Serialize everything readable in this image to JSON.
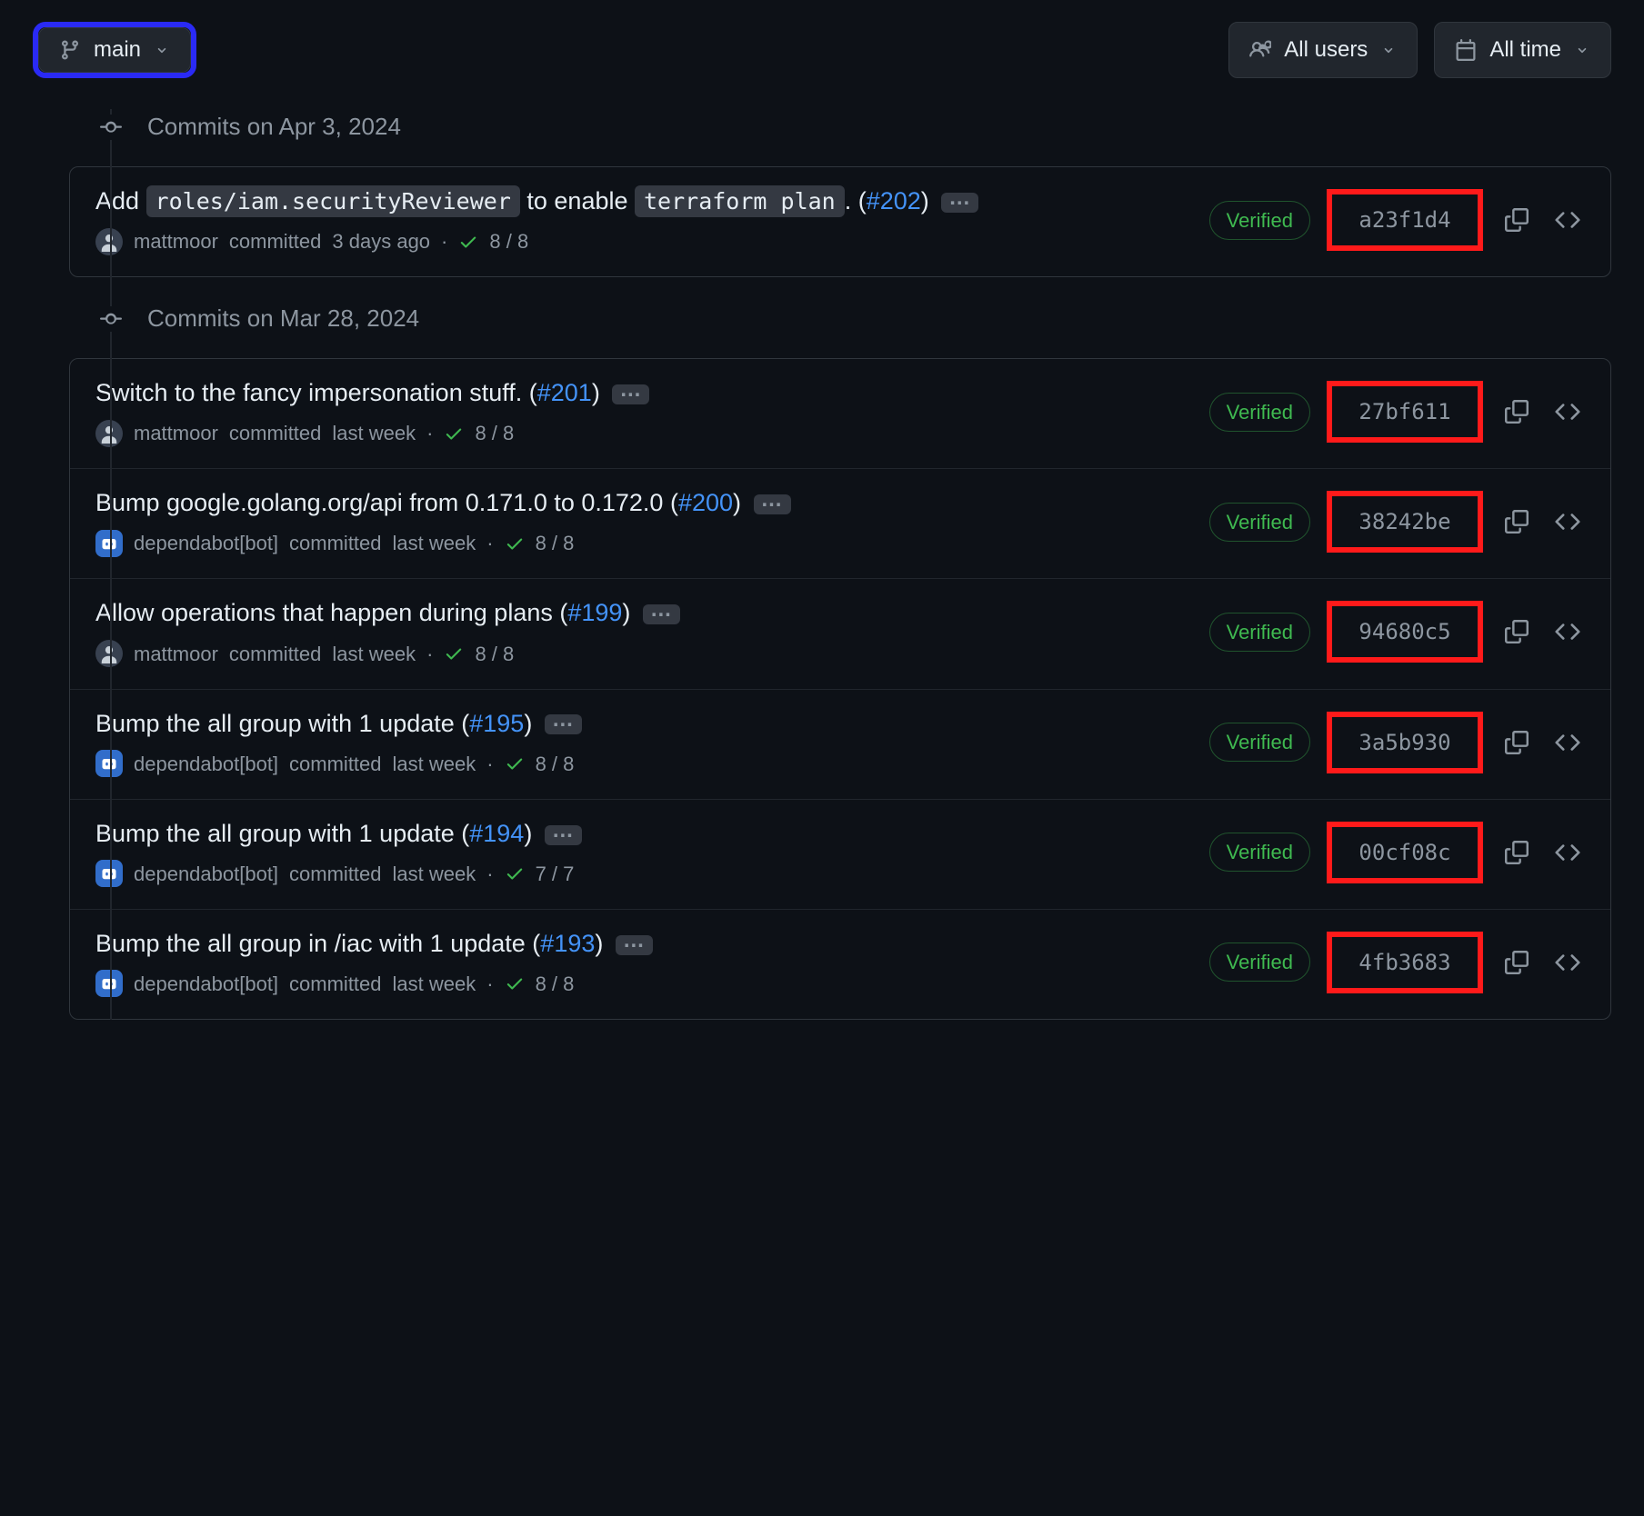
{
  "toolbar": {
    "branch_label": "main",
    "users_label": "All users",
    "time_label": "All time"
  },
  "groups": [
    {
      "date_label": "Commits on Apr 3, 2024",
      "commits": [
        {
          "title_pre": "Add ",
          "code1": "roles/iam.securityReviewer",
          "mid": " to enable ",
          "code2": "terraform plan",
          "post": ". (",
          "pr": "#202",
          "close": ")",
          "author": "mattmoor",
          "author_kind": "user",
          "time_ago": "3 days ago",
          "checks": "8 / 8",
          "verified": "Verified",
          "sha": "a23f1d4"
        }
      ]
    },
    {
      "date_label": "Commits on Mar 28, 2024",
      "commits": [
        {
          "title_pre": "Switch to the fancy impersonation stuff. (",
          "pr": "#201",
          "close": ")",
          "author": "mattmoor",
          "author_kind": "user",
          "time_ago": "last week",
          "checks": "8 / 8",
          "verified": "Verified",
          "sha": "27bf611"
        },
        {
          "title_pre": "Bump google.golang.org/api from 0.171.0 to 0.172.0 (",
          "pr": "#200",
          "close": ")",
          "author": "dependabot[bot]",
          "author_kind": "bot",
          "time_ago": "last week",
          "checks": "8 / 8",
          "verified": "Verified",
          "sha": "38242be"
        },
        {
          "title_pre": "Allow operations that happen during plans (",
          "pr": "#199",
          "close": ")",
          "author": "mattmoor",
          "author_kind": "user",
          "time_ago": "last week",
          "checks": "8 / 8",
          "verified": "Verified",
          "sha": "94680c5"
        },
        {
          "title_pre": "Bump the all group with 1 update (",
          "pr": "#195",
          "close": ")",
          "author": "dependabot[bot]",
          "author_kind": "bot",
          "time_ago": "last week",
          "checks": "8 / 8",
          "verified": "Verified",
          "sha": "3a5b930"
        },
        {
          "title_pre": "Bump the all group with 1 update (",
          "pr": "#194",
          "close": ")",
          "author": "dependabot[bot]",
          "author_kind": "bot",
          "time_ago": "last week",
          "checks": "7 / 7",
          "verified": "Verified",
          "sha": "00cf08c"
        },
        {
          "title_pre": "Bump the all group in /iac with 1 update (",
          "pr": "#193",
          "close": ")",
          "author": "dependabot[bot]",
          "author_kind": "bot",
          "time_ago": "last week",
          "checks": "8 / 8",
          "verified": "Verified",
          "sha": "4fb3683"
        }
      ]
    }
  ]
}
